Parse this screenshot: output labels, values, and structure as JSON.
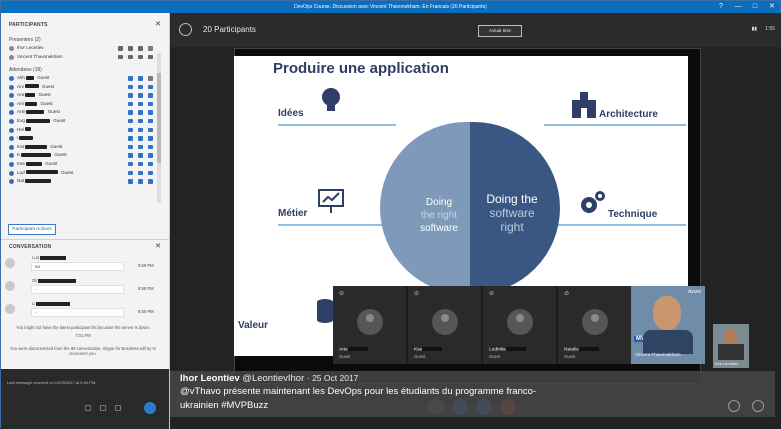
{
  "window": {
    "title": "DevOps Course. Discussion avec Vincent Thavonekham. En Francais (20 Participants)",
    "controls": [
      "?",
      "—",
      "□",
      "✕"
    ]
  },
  "participants_panel": {
    "title": "PARTICIPANTS",
    "presenters_header": "Presenters (2)",
    "presenters": [
      "Ihor Leontiev",
      "Vincent Thavonekham"
    ],
    "attendees_header": "Attendees (18)",
    "attendees": [
      {
        "name": "Akh",
        "role": "Guest"
      },
      {
        "name": "Ani",
        "role": "Guest"
      },
      {
        "name": "Ara",
        "role": "Guest"
      },
      {
        "name": "Arn",
        "role": "Guest"
      },
      {
        "name": "Arte",
        "role": "Guest"
      },
      {
        "name": "Evg",
        "role": "Guest"
      },
      {
        "name": "Hel",
        "role": ""
      },
      {
        "name": "I",
        "role": ""
      },
      {
        "name": "Kat",
        "role": "Guest"
      },
      {
        "name": "K",
        "role": "Guest"
      },
      {
        "name": "Kse",
        "role": "Guest"
      },
      {
        "name": "Lud",
        "role": "Guest"
      },
      {
        "name": "Nat",
        "role": ""
      }
    ],
    "actions_button": "Participant Actions"
  },
  "conversation": {
    "title": "CONVERSATION",
    "messages": [
      {
        "sender": "Lud",
        "text": "no",
        "time": "6:50 PM"
      },
      {
        "sender": "Oli",
        "text": "-",
        "time": "6:50 PM"
      },
      {
        "sender": "Li",
        "text": "-",
        "time": "6:50 PM"
      }
    ],
    "notice_list": "You might not have the latest participant list because the server is down.",
    "notice_time": "7:01 PM",
    "notice_disconnect": "You were disconnected from the IM conversation. Skype for Business will try to reconnect you.",
    "last_message": "Last message received on 10/25/2017 at 6:50 PM."
  },
  "meeting": {
    "participants_count": "20 Participants",
    "actual_size_button": "Actual Size",
    "time_indicator": "1:55"
  },
  "slide": {
    "title": "Produire une application",
    "labels": {
      "idees": "Idées",
      "architecture": "Architecture",
      "metier": "Métier",
      "technique": "Technique",
      "valeur": "Valeur"
    },
    "left_text": {
      "l1": "Doing",
      "l2": "the right",
      "l3": "software"
    },
    "right_text": {
      "l1": "Doing the",
      "l2": "software",
      "l3": "right"
    },
    "colors": {
      "title": "#2f3e66",
      "left": "#7e99b9",
      "right": "#3a5784",
      "line": "#8fc0e5"
    }
  },
  "video_tiles": [
    {
      "name": "Arte",
      "role": "Guest"
    },
    {
      "name": "Kse",
      "role": "Guest"
    },
    {
      "name": "Ludmila",
      "role": "Guest"
    },
    {
      "name": "Natalie",
      "role": "Guest"
    }
  ],
  "presenter_video": {
    "name": "Vincent Thavonekham",
    "badge": "Azure",
    "logo": "MVP"
  },
  "self_video": {
    "name": "Ihor Leontiev"
  },
  "tweet": {
    "author": "Ihor Leontiev",
    "handle": "@LeontievIhor",
    "date": "· 25 Oct 2017",
    "line1": "@vThavo  présente maintenant les DevOps pour les étudiants du programme franco-",
    "line2": "ukrainien #MVPBuzz"
  }
}
